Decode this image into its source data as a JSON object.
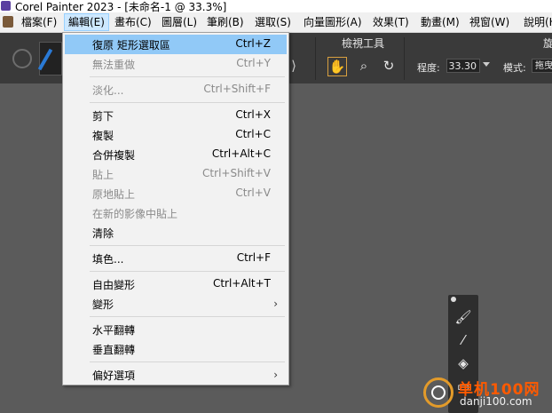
{
  "window": {
    "title": "Corel Painter 2023 - [未命名-1 @ 33.3%]"
  },
  "menubar": {
    "items": [
      {
        "label": "檔案(F)",
        "active": false
      },
      {
        "label": "編輯(E)",
        "active": true
      },
      {
        "label": "畫布(C)",
        "active": false
      },
      {
        "label": "圖層(L)",
        "active": false
      },
      {
        "label": "筆刷(B)",
        "active": false
      },
      {
        "label": "選取(S)",
        "active": false
      },
      {
        "label": "向量圖形(A)",
        "active": false
      },
      {
        "label": "效果(T)",
        "active": false
      },
      {
        "label": "動畫(M)",
        "active": false
      },
      {
        "label": "視窗(W)",
        "active": false
      },
      {
        "label": "說明(H",
        "active": false
      }
    ]
  },
  "toolbar": {
    "view_tools_label": "檢視工具",
    "right_panel_label": "旋",
    "zoom_label": "程度:",
    "zoom_value": "33.30",
    "mode_label": "模式:",
    "mode_value": "拖曳"
  },
  "edit_menu": {
    "items": [
      {
        "label": "復原 矩形選取區",
        "shortcut": "Ctrl+Z",
        "enabled": true,
        "highlight": true
      },
      {
        "label": "無法重做",
        "shortcut": "Ctrl+Y",
        "enabled": false
      },
      {
        "separator": true
      },
      {
        "label": "淡化...",
        "shortcut": "Ctrl+Shift+F",
        "enabled": false
      },
      {
        "separator": true
      },
      {
        "label": "剪下",
        "shortcut": "Ctrl+X",
        "enabled": true
      },
      {
        "label": "複製",
        "shortcut": "Ctrl+C",
        "enabled": true
      },
      {
        "label": "合併複製",
        "shortcut": "Ctrl+Alt+C",
        "enabled": true
      },
      {
        "label": "貼上",
        "shortcut": "Ctrl+Shift+V",
        "enabled": false
      },
      {
        "label": "原地貼上",
        "shortcut": "Ctrl+V",
        "enabled": false
      },
      {
        "label": "在新的影像中貼上",
        "shortcut": "",
        "enabled": false
      },
      {
        "label": "清除",
        "shortcut": "",
        "enabled": true
      },
      {
        "separator": true
      },
      {
        "label": "填色...",
        "shortcut": "Ctrl+F",
        "enabled": true
      },
      {
        "separator": true
      },
      {
        "label": "自由變形",
        "shortcut": "Ctrl+Alt+T",
        "enabled": true
      },
      {
        "label": "變形",
        "shortcut": "",
        "enabled": true,
        "submenu": true
      },
      {
        "separator": true
      },
      {
        "label": "水平翻轉",
        "shortcut": "",
        "enabled": true
      },
      {
        "label": "垂直翻轉",
        "shortcut": "",
        "enabled": true
      },
      {
        "separator": true
      },
      {
        "label": "偏好選項",
        "shortcut": "",
        "enabled": true,
        "submenu": true
      }
    ]
  },
  "watermark": {
    "brand": "单机100网",
    "url": "danji100.com"
  },
  "colors": {
    "highlight": "#91c9f7",
    "toolbar": "#3a3a3a",
    "canvas": "#5b5b5b",
    "accent": "#d8a040"
  },
  "icons": [
    "reset-icon",
    "brush-icon",
    "hand-icon",
    "zoom-icon",
    "rotate-icon",
    "brush-small-icon",
    "dropper-icon",
    "paint-bucket-icon",
    "rectangle-icon"
  ]
}
